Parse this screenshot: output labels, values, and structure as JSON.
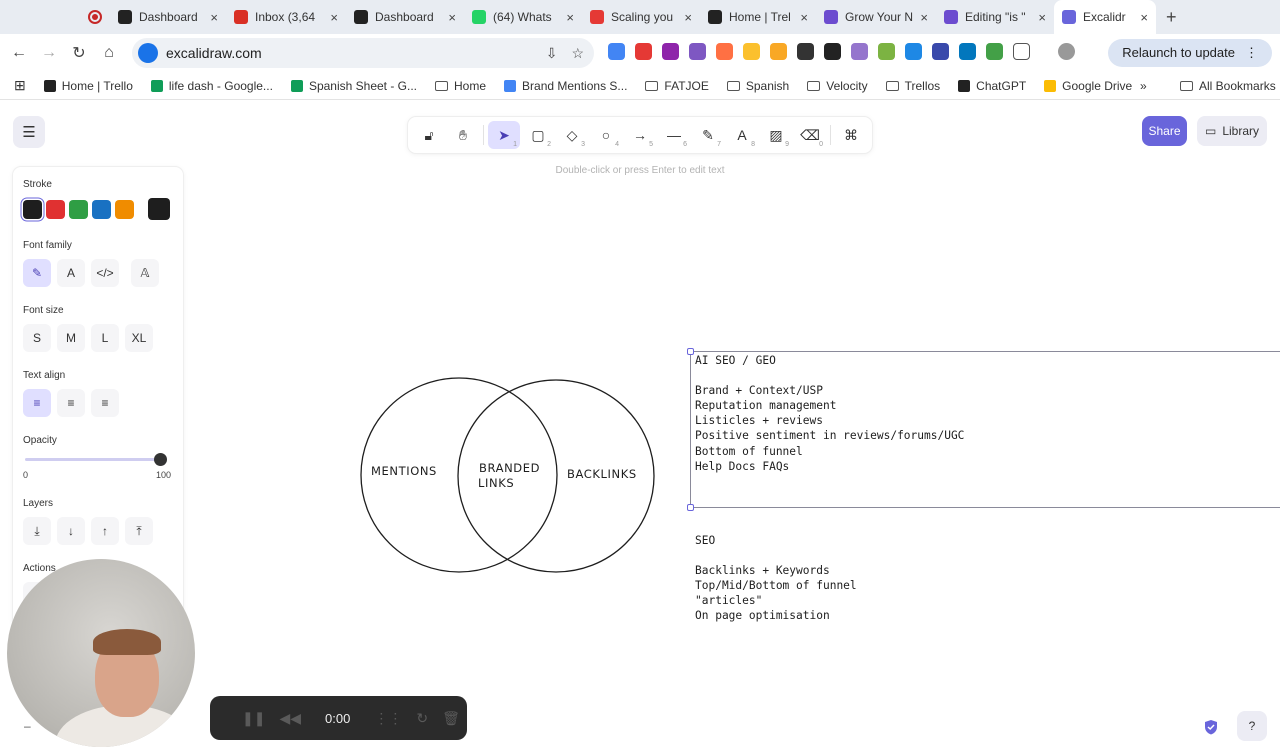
{
  "browser": {
    "tabs": [
      {
        "title": "Dashboard",
        "favicon": "github-icon",
        "color": "#222222"
      },
      {
        "title": "Inbox (3,64",
        "favicon": "gmail-icon",
        "color": "#d93025"
      },
      {
        "title": "Dashboard",
        "favicon": "github-icon",
        "color": "#222222"
      },
      {
        "title": "(64) Whats",
        "favicon": "whatsapp-icon",
        "color": "#25d366"
      },
      {
        "title": "Scaling you",
        "favicon": "sk-icon",
        "color": "#e53935"
      },
      {
        "title": "Home | Trel",
        "favicon": "notion-icon",
        "color": "#222222"
      },
      {
        "title": "Grow Your N",
        "favicon": "app-icon",
        "color": "#6c4ccf"
      },
      {
        "title": "Editing \"is \"",
        "favicon": "app-icon",
        "color": "#6c4ccf"
      },
      {
        "title": "Excalidr",
        "favicon": "excalidraw-icon",
        "color": "#6965db",
        "active": true
      }
    ],
    "url": "excalidraw.com",
    "relaunch_label": "Relaunch to update",
    "bookmarks": [
      {
        "label": "Home | Trello",
        "type": "notion",
        "color": "#222222"
      },
      {
        "label": "life dash - Google...",
        "type": "sheet",
        "color": "#0f9d58"
      },
      {
        "label": "Spanish Sheet - G...",
        "type": "sheet",
        "color": "#0f9d58"
      },
      {
        "label": "Home",
        "type": "folder"
      },
      {
        "label": "Brand Mentions S...",
        "type": "doc",
        "color": "#4285f4"
      },
      {
        "label": "FATJOE",
        "type": "folder"
      },
      {
        "label": "Spanish",
        "type": "folder"
      },
      {
        "label": "Velocity",
        "type": "folder"
      },
      {
        "label": "Trellos",
        "type": "folder"
      },
      {
        "label": "ChatGPT",
        "type": "chatgpt",
        "color": "#222222"
      },
      {
        "label": "Google Drive",
        "type": "drive",
        "color": "#fbbc04"
      }
    ],
    "all_bookmarks_label": "All Bookmarks"
  },
  "app": {
    "hint": "Double-click or press Enter to edit text",
    "share_label": "Share",
    "library_label": "Library",
    "tools": [
      {
        "name": "lock-icon",
        "glyph": "🔓︎",
        "num": ""
      },
      {
        "name": "hand-icon",
        "glyph": "✋︎",
        "num": ""
      },
      {
        "name": "selection-icon",
        "glyph": "➤",
        "num": "1",
        "selected": true
      },
      {
        "name": "rectangle-icon",
        "glyph": "▢",
        "num": "2"
      },
      {
        "name": "diamond-icon",
        "glyph": "◇",
        "num": "3"
      },
      {
        "name": "ellipse-icon",
        "glyph": "○",
        "num": "4"
      },
      {
        "name": "arrow-icon",
        "glyph": "→",
        "num": "5"
      },
      {
        "name": "line-icon",
        "glyph": "—",
        "num": "6"
      },
      {
        "name": "pencil-icon",
        "glyph": "✎",
        "num": "7"
      },
      {
        "name": "text-icon",
        "glyph": "A",
        "num": "8"
      },
      {
        "name": "image-icon",
        "glyph": "▨",
        "num": "9"
      },
      {
        "name": "eraser-icon",
        "glyph": "⌫",
        "num": "0"
      },
      {
        "name": "shapes-icon",
        "glyph": "⌘",
        "num": ""
      }
    ],
    "properties": {
      "stroke_label": "Stroke",
      "stroke_colors": [
        "#1e1e1e",
        "#e03131",
        "#2f9e44",
        "#1971c2",
        "#f08c00"
      ],
      "current_stroke": "#1e1e1e",
      "font_family_label": "Font family",
      "font_size_label": "Font size",
      "font_sizes": [
        "S",
        "M",
        "L",
        "XL"
      ],
      "text_align_label": "Text align",
      "opacity_label": "Opacity",
      "opacity_min": "0",
      "opacity_max": "100",
      "opacity_value": 100,
      "layers_label": "Layers",
      "actions_label": "Actions"
    },
    "venn": {
      "left": "MENTIONS",
      "center_line1": "BRANDED",
      "center_line2": "LINKS",
      "right": "BACKLINKS"
    },
    "notes": {
      "geo": "AI SEO / GEO\n\nBrand + Context/USP\nReputation management\nListicles + reviews\nPositive sentiment in reviews/forums/UGC\nBottom of funnel\nHelp Docs FAQs",
      "seo": "SEO\n\nBacklinks + Keywords\nTop/Mid/Bottom of funnel\n\"articles\"\nOn page optimisation"
    },
    "recorder_time": "0:00"
  }
}
